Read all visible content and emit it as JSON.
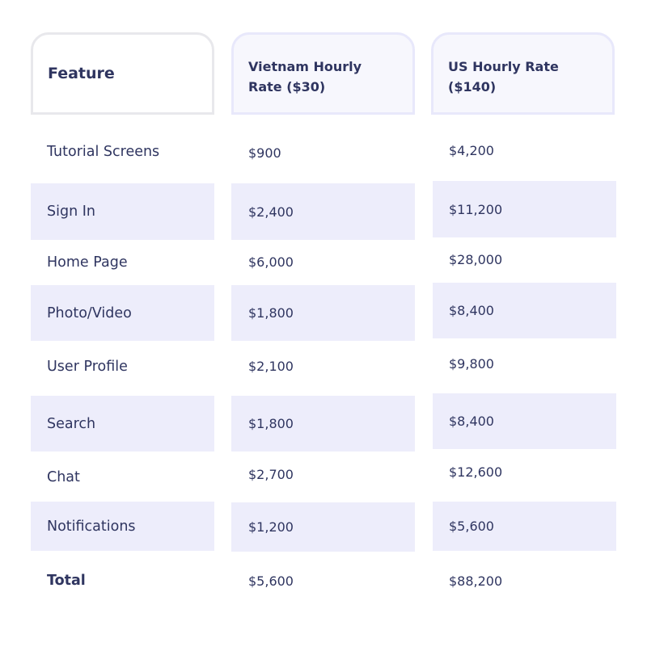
{
  "table": {
    "headers": [
      "Feature",
      "Vietnam Hourly Rate ($30)",
      "US Hourly Rate ($140)"
    ],
    "rows": [
      {
        "feature": "Tutorial Screens",
        "vietnam": "$900",
        "us": "$4,200"
      },
      {
        "feature": "Sign In",
        "vietnam": "$2,400",
        "us": "$11,200"
      },
      {
        "feature": "Home Page",
        "vietnam": "$6,000",
        "us": "$28,000"
      },
      {
        "feature": "Photo/Video",
        "vietnam": "$1,800",
        "us": "$8,400"
      },
      {
        "feature": "User Profile",
        "vietnam": "$2,100",
        "us": "$9,800"
      },
      {
        "feature": "Search",
        "vietnam": "$1,800",
        "us": "$8,400"
      },
      {
        "feature": "Chat",
        "vietnam": "$2,700",
        "us": "$12,600"
      },
      {
        "feature": "Notifications",
        "vietnam": "$1,200",
        "us": "$5,600"
      },
      {
        "feature": "Total",
        "vietnam": "$5,600",
        "us": "$88,200"
      }
    ]
  },
  "colors": {
    "text": "#2f3560",
    "row_highlight": "#ededfb",
    "header_bg": "#f7f7fd",
    "header_border": "#e8e8fb"
  }
}
